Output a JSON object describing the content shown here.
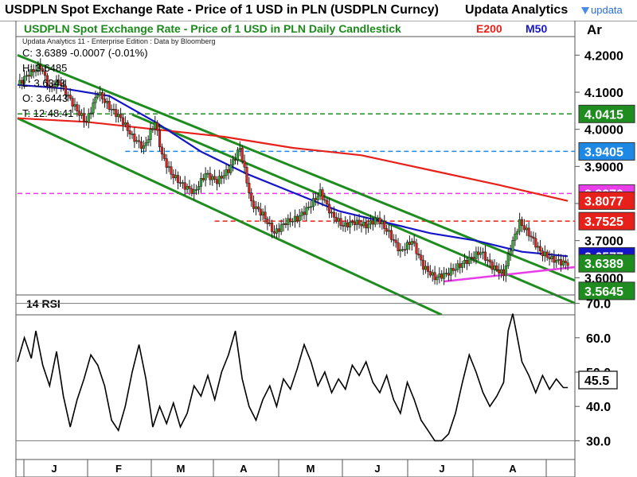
{
  "header": {
    "title": "USDPLN Spot Exchange Rate - Price of 1 USD in PLN (USDPLN Curncy)",
    "brand": "Updata Analytics",
    "logo_text": "updata"
  },
  "price_panel": {
    "title": "USDPLN Spot Exchange Rate - Price of 1 USD in PLN Daily Candlestick",
    "title_color": "#1b8a1b",
    "ma200_label": "E200",
    "ma200_color": "#e8201a",
    "ma50_label": "M50",
    "ma50_color": "#1515c8",
    "source_line": "Updata Analytics 11 - Enterprise Edition : Data by Bloomberg",
    "corner_label": "Ar",
    "info_close": "C: 3.6389  -0.0007 (-0.01%)",
    "info_high": "H: 3.6485",
    "info_low": "L: 3.6343",
    "info_open": "O: 3.6443",
    "info_time": "T: 12:48:41",
    "axis_ticks": [
      "4.2000",
      "4.1000",
      "4.0000",
      "3.9000",
      "3.8000",
      "3.7000",
      "3.6000"
    ],
    "badges": [
      {
        "text": "4.0415",
        "color": "#1f8c1f"
      },
      {
        "text": "3.9405",
        "color": "#1e88e5"
      },
      {
        "text": "3.8270",
        "color": "#e83de8"
      },
      {
        "text": "3.8077",
        "color": "#e8201a"
      },
      {
        "text": "3.7525",
        "color": "#e8201a"
      },
      {
        "text": "3.6577",
        "color": "#1515c8"
      },
      {
        "text": "3.6389",
        "color": "#1f8c1f"
      },
      {
        "text": "3.5645",
        "color": "#1f8c1f"
      }
    ]
  },
  "rsi_panel": {
    "label": "14 RSI",
    "axis_ticks": [
      "70.0",
      "60.0",
      "50.0",
      "40.0",
      "30.0"
    ],
    "current_badge": "45.5"
  },
  "x_axis": {
    "months": [
      "J",
      "F",
      "M",
      "A",
      "M",
      "J",
      "J",
      "A"
    ]
  },
  "chart_data": [
    {
      "type": "candlestick",
      "title": "USDPLN Spot Exchange Rate - Price of 1 USD in PLN Daily Candlestick",
      "x_labels": [
        "J",
        "F",
        "M",
        "A",
        "M",
        "J",
        "J",
        "A"
      ],
      "ylim": [
        3.5,
        4.25
      ],
      "grid": false,
      "close_path": [
        {
          "day": 0,
          "close": 4.12
        },
        {
          "day": 5,
          "close": 4.15
        },
        {
          "day": 10,
          "close": 4.17
        },
        {
          "day": 14,
          "close": 4.11
        },
        {
          "day": 18,
          "close": 4.13
        },
        {
          "day": 22,
          "close": 4.09
        },
        {
          "day": 26,
          "close": 4.05
        },
        {
          "day": 30,
          "close": 4.02
        },
        {
          "day": 35,
          "close": 4.1
        },
        {
          "day": 40,
          "close": 4.06
        },
        {
          "day": 45,
          "close": 4.03
        },
        {
          "day": 50,
          "close": 3.98
        },
        {
          "day": 55,
          "close": 3.95
        },
        {
          "day": 60,
          "close": 4.02
        },
        {
          "day": 63,
          "close": 3.93
        },
        {
          "day": 67,
          "close": 3.88
        },
        {
          "day": 72,
          "close": 3.85
        },
        {
          "day": 77,
          "close": 3.83
        },
        {
          "day": 82,
          "close": 3.88
        },
        {
          "day": 87,
          "close": 3.86
        },
        {
          "day": 92,
          "close": 3.89
        },
        {
          "day": 97,
          "close": 3.95
        },
        {
          "day": 102,
          "close": 3.8
        },
        {
          "day": 107,
          "close": 3.77
        },
        {
          "day": 112,
          "close": 3.72
        },
        {
          "day": 117,
          "close": 3.75
        },
        {
          "day": 122,
          "close": 3.76
        },
        {
          "day": 127,
          "close": 3.79
        },
        {
          "day": 132,
          "close": 3.83
        },
        {
          "day": 137,
          "close": 3.77
        },
        {
          "day": 142,
          "close": 3.74
        },
        {
          "day": 147,
          "close": 3.75
        },
        {
          "day": 152,
          "close": 3.74
        },
        {
          "day": 157,
          "close": 3.76
        },
        {
          "day": 162,
          "close": 3.72
        },
        {
          "day": 167,
          "close": 3.67
        },
        {
          "day": 172,
          "close": 3.7
        },
        {
          "day": 177,
          "close": 3.63
        },
        {
          "day": 182,
          "close": 3.6
        },
        {
          "day": 187,
          "close": 3.61
        },
        {
          "day": 192,
          "close": 3.63
        },
        {
          "day": 197,
          "close": 3.65
        },
        {
          "day": 202,
          "close": 3.67
        },
        {
          "day": 207,
          "close": 3.63
        },
        {
          "day": 212,
          "close": 3.61
        },
        {
          "day": 215,
          "close": 3.68
        },
        {
          "day": 219,
          "close": 3.75
        },
        {
          "day": 224,
          "close": 3.71
        },
        {
          "day": 228,
          "close": 3.67
        },
        {
          "day": 233,
          "close": 3.65
        },
        {
          "day": 238,
          "close": 3.64
        },
        {
          "day": 240,
          "close": 3.6389
        }
      ],
      "moving_averages": [
        {
          "name": "E200",
          "color": "#e8201a",
          "points": [
            {
              "day": 0,
              "value": 4.03
            },
            {
              "day": 30,
              "value": 4.02
            },
            {
              "day": 60,
              "value": 4.0
            },
            {
              "day": 90,
              "value": 3.98
            },
            {
              "day": 120,
              "value": 3.95
            },
            {
              "day": 150,
              "value": 3.93
            },
            {
              "day": 180,
              "value": 3.89
            },
            {
              "day": 210,
              "value": 3.85
            },
            {
              "day": 240,
              "value": 3.807
            }
          ]
        },
        {
          "name": "M50",
          "color": "#1515c8",
          "points": [
            {
              "day": 0,
              "value": 4.12
            },
            {
              "day": 20,
              "value": 4.11
            },
            {
              "day": 40,
              "value": 4.09
            },
            {
              "day": 60,
              "value": 4.02
            },
            {
              "day": 80,
              "value": 3.94
            },
            {
              "day": 100,
              "value": 3.88
            },
            {
              "day": 120,
              "value": 3.83
            },
            {
              "day": 140,
              "value": 3.78
            },
            {
              "day": 160,
              "value": 3.75
            },
            {
              "day": 180,
              "value": 3.72
            },
            {
              "day": 200,
              "value": 3.7
            },
            {
              "day": 220,
              "value": 3.67
            },
            {
              "day": 240,
              "value": 3.658
            }
          ]
        }
      ],
      "horizontal_levels": [
        {
          "value": 4.0415,
          "color": "#1f8c1f",
          "start_day": 0
        },
        {
          "value": 3.9405,
          "color": "#1e88e5",
          "start_day": 47
        },
        {
          "value": 3.827,
          "color": "#e83de8",
          "start_day": 0
        },
        {
          "value": 3.7525,
          "color": "#e8201a",
          "start_day": 86
        }
      ],
      "trend_channel": [
        {
          "from": {
            "day": 0,
            "value": 4.2
          },
          "to": {
            "day": 260,
            "value": 3.55
          }
        },
        {
          "from": {
            "day": 0,
            "value": 4.03
          },
          "to": {
            "day": 185,
            "value": 3.5
          }
        },
        {
          "from": {
            "day": 50,
            "value": 4.04
          },
          "to": {
            "day": 255,
            "value": 3.5
          }
        }
      ],
      "support_line": {
        "from": {
          "day": 186,
          "value": 3.59
        },
        "to": {
          "day": 245,
          "value": 3.63
        },
        "color": "#e83de8"
      }
    },
    {
      "type": "line",
      "title": "14 RSI",
      "ylim": [
        25,
        72
      ],
      "grid_levels": [
        70,
        30
      ],
      "series": [
        {
          "values": [
            {
              "day": 0,
              "value": 53
            },
            {
              "day": 3,
              "value": 60
            },
            {
              "day": 6,
              "value": 54
            },
            {
              "day": 8,
              "value": 62
            },
            {
              "day": 11,
              "value": 52
            },
            {
              "day": 14,
              "value": 46
            },
            {
              "day": 17,
              "value": 56
            },
            {
              "day": 20,
              "value": 43
            },
            {
              "day": 23,
              "value": 34
            },
            {
              "day": 26,
              "value": 42
            },
            {
              "day": 29,
              "value": 48
            },
            {
              "day": 32,
              "value": 55
            },
            {
              "day": 35,
              "value": 52
            },
            {
              "day": 38,
              "value": 46
            },
            {
              "day": 41,
              "value": 36
            },
            {
              "day": 44,
              "value": 33
            },
            {
              "day": 47,
              "value": 40
            },
            {
              "day": 50,
              "value": 50
            },
            {
              "day": 53,
              "value": 58
            },
            {
              "day": 56,
              "value": 48
            },
            {
              "day": 59,
              "value": 34
            },
            {
              "day": 62,
              "value": 40
            },
            {
              "day": 65,
              "value": 35
            },
            {
              "day": 68,
              "value": 41
            },
            {
              "day": 71,
              "value": 34
            },
            {
              "day": 74,
              "value": 38
            },
            {
              "day": 77,
              "value": 46
            },
            {
              "day": 80,
              "value": 43
            },
            {
              "day": 83,
              "value": 49
            },
            {
              "day": 86,
              "value": 42
            },
            {
              "day": 89,
              "value": 50
            },
            {
              "day": 92,
              "value": 55
            },
            {
              "day": 95,
              "value": 62
            },
            {
              "day": 98,
              "value": 48
            },
            {
              "day": 101,
              "value": 40
            },
            {
              "day": 104,
              "value": 36
            },
            {
              "day": 107,
              "value": 42
            },
            {
              "day": 110,
              "value": 46
            },
            {
              "day": 113,
              "value": 40
            },
            {
              "day": 116,
              "value": 48
            },
            {
              "day": 119,
              "value": 45
            },
            {
              "day": 122,
              "value": 51
            },
            {
              "day": 125,
              "value": 58
            },
            {
              "day": 128,
              "value": 53
            },
            {
              "day": 131,
              "value": 46
            },
            {
              "day": 134,
              "value": 50
            },
            {
              "day": 137,
              "value": 44
            },
            {
              "day": 140,
              "value": 48
            },
            {
              "day": 143,
              "value": 45
            },
            {
              "day": 146,
              "value": 52
            },
            {
              "day": 149,
              "value": 49
            },
            {
              "day": 152,
              "value": 53
            },
            {
              "day": 155,
              "value": 47
            },
            {
              "day": 158,
              "value": 44
            },
            {
              "day": 161,
              "value": 49
            },
            {
              "day": 164,
              "value": 42
            },
            {
              "day": 167,
              "value": 38
            },
            {
              "day": 170,
              "value": 47
            },
            {
              "day": 173,
              "value": 42
            },
            {
              "day": 176,
              "value": 36
            },
            {
              "day": 179,
              "value": 33
            },
            {
              "day": 182,
              "value": 30
            },
            {
              "day": 185,
              "value": 30
            },
            {
              "day": 188,
              "value": 32
            },
            {
              "day": 191,
              "value": 38
            },
            {
              "day": 194,
              "value": 47
            },
            {
              "day": 197,
              "value": 55
            },
            {
              "day": 200,
              "value": 50
            },
            {
              "day": 203,
              "value": 44
            },
            {
              "day": 206,
              "value": 40
            },
            {
              "day": 209,
              "value": 43
            },
            {
              "day": 212,
              "value": 47
            },
            {
              "day": 214,
              "value": 62
            },
            {
              "day": 216,
              "value": 67
            },
            {
              "day": 218,
              "value": 60
            },
            {
              "day": 220,
              "value": 53
            },
            {
              "day": 223,
              "value": 49
            },
            {
              "day": 226,
              "value": 44
            },
            {
              "day": 229,
              "value": 49
            },
            {
              "day": 232,
              "value": 45
            },
            {
              "day": 235,
              "value": 48
            },
            {
              "day": 238,
              "value": 45.5
            },
            {
              "day": 240,
              "value": 45.5
            }
          ]
        }
      ]
    }
  ]
}
